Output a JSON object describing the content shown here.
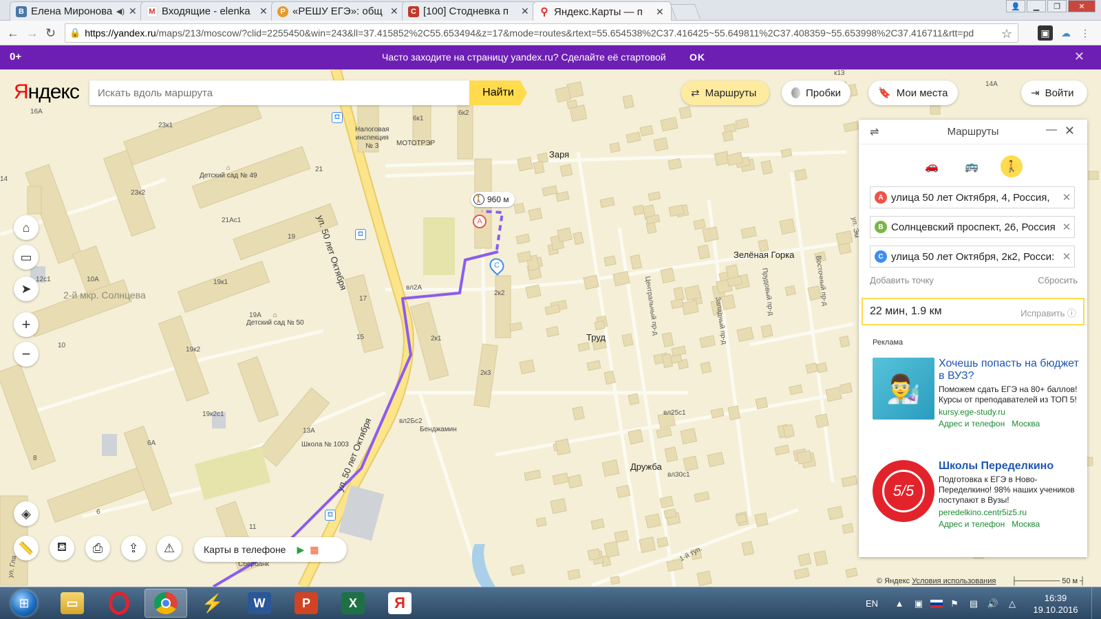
{
  "browser": {
    "tabs": [
      {
        "title": "Елена Миронова",
        "icon": "vk-icon",
        "color": "#4a76a8",
        "glyph": "В"
      },
      {
        "title": "Входящие - elenka",
        "icon": "gmail-icon",
        "color": "#d93025",
        "glyph": "M"
      },
      {
        "title": "«РЕШУ ЕГЭ»: общ",
        "icon": "reshuege-icon",
        "color": "#e89a2c",
        "glyph": "Р"
      },
      {
        "title": "[100] Стодневка п",
        "icon": "stodnevka-icon",
        "color": "#c0392b",
        "glyph": "С"
      },
      {
        "title": "Яндекс.Карты — п",
        "icon": "yandex-maps-icon",
        "color": "#e52620",
        "glyph": "⚲"
      }
    ],
    "url_host": "https://yandex.ru",
    "url_rest": "/maps/213/moscow/?clid=2255450&win=243&ll=37.415852%2C55.653494&z=17&mode=routes&rtext=55.654538%2C37.416425~55.649811%2C37.408359~55.653998%2C37.416711&rtt=pd"
  },
  "promo": {
    "age": "0+",
    "message": "Часто заходите на страницу yandex.ru? Сделайте её стартовой",
    "ok": "OK"
  },
  "header": {
    "logo_first": "Я",
    "logo_rest": "ндекс",
    "search_placeholder": "Искать вдоль маршрута",
    "find": "Найти",
    "routes": "Маршруты",
    "traffic": "Пробки",
    "my_places": "Мои места",
    "login": "Войти"
  },
  "map_labels": {
    "house_16a": "16А",
    "house_23k1": "23к1",
    "house_14": "14",
    "house_23k2": "23к2",
    "house_21": "21",
    "house_21ac1": "21Ас1",
    "house_19": "19",
    "house_19k1": "19к1",
    "house_12c1": "12с1",
    "house_10a": "10А",
    "house_17": "17",
    "house_19a": "19А",
    "house_15": "15",
    "house_10": "10",
    "house_19k2": "19к2",
    "house_19k2c1": "19к2с1",
    "house_6a": "6А",
    "house_13a": "13А",
    "house_8": "8",
    "house_6": "6",
    "house_11": "11",
    "house_6k1": "6к1",
    "house_6k2": "6к2",
    "house_2k2": "2к2",
    "house_2k1": "2к1",
    "house_2k3": "2к3",
    "house_vl2a": "вл2А",
    "house_vl2b2": "вл2Бс2",
    "house_vl25c1": "вл25с1",
    "house_vl30c1": "вл30с1",
    "house_k13": "к13",
    "house_14a": "14А",
    "kindergarten_49": "Детский сад № 49",
    "kindergarten_50": "Детский сад № 50",
    "tax": "Налоговая\nинспекция\n№ 3",
    "moto": "МОТОТРЭР",
    "school": "Школа № 1003",
    "benjamin": "Бенджамин",
    "sberbank": "Сбербанк",
    "district": "2-й мкр. Солнцева",
    "zarya": "Заря",
    "zelenaya": "Зелёная Горка",
    "trud": "Труд",
    "druzhba": "Дружба",
    "street_main": "ул. 50 лет Октября",
    "street_main2": "ул. 50 лет Октября",
    "street_central": "Центральный пр-д",
    "street_west": "Западный пр-д",
    "street_prud": "Прудовый пр-д",
    "street_east": "Восточный пр-д",
    "street_ul": "ул. Эм",
    "street_1tup": "1-й туп.",
    "street_ulgl": "ул. Гла",
    "distance": "960 м",
    "marker_a": "А",
    "marker_c": "С"
  },
  "phone": {
    "label": "Карты в телефоне"
  },
  "route_panel": {
    "title": "Маршруты",
    "points": [
      {
        "badge": "A",
        "color": "#f0524a",
        "value": "улица 50 лет Октября, 4, Россия,"
      },
      {
        "badge": "B",
        "color": "#7ab648",
        "value": "Солнцевский проспект, 26, Россия"
      },
      {
        "badge": "C",
        "color": "#3d8ef0",
        "value": "улица 50 лет Октября, 2к2, Росси:"
      }
    ],
    "add_point": "Добавить точку",
    "reset": "Сбросить",
    "result": "22 мин, 1.9 км",
    "fix": "Исправить",
    "ads_header": "Реклама",
    "ads": [
      {
        "headline": "Хочешь попасть на бюджет в ВУЗ?",
        "text": "Поможем сдать ЕГЭ на 80+ баллов! Курсы от преподавателей из ТОП 5!",
        "url": "kursy.ege-study.ru",
        "link1": "Адрес и телефон",
        "link2": "Москва"
      },
      {
        "headline": "Школы Переделкино",
        "text": "Подготовка к ЕГЭ в Ново-Переделкино! 98% наших учеников поступают в Вузы!",
        "url": "peredelkino.centr5iz5.ru",
        "link1": "Адрес и телефон",
        "link2": "Москва",
        "logo_text": "5/5"
      }
    ]
  },
  "footer": {
    "copyright": "© Яндекс",
    "terms": "Условия использования",
    "scale": "50 м"
  },
  "taskbar": {
    "lang": "EN",
    "time": "16:39",
    "date": "19.10.2016"
  }
}
